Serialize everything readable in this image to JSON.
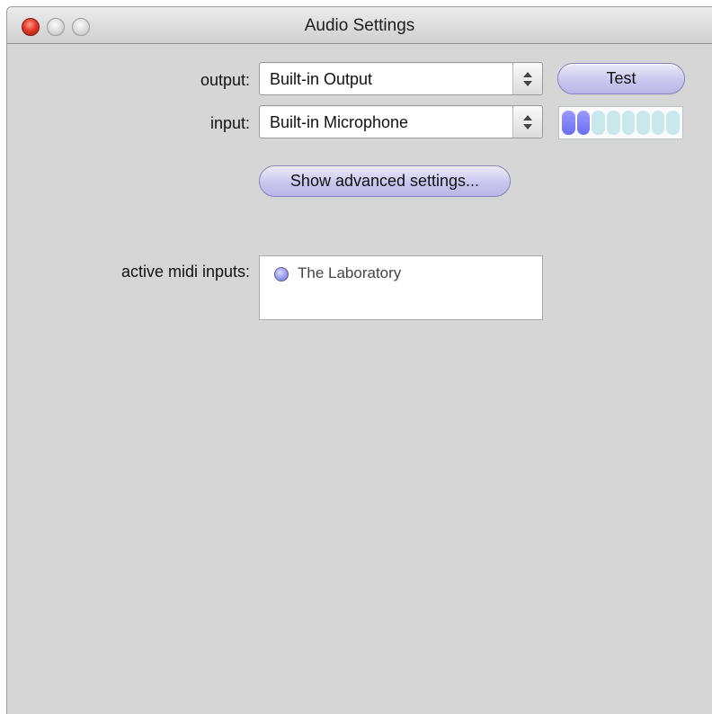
{
  "window": {
    "title": "Audio Settings"
  },
  "output": {
    "label": "output:",
    "value": "Built-in Output"
  },
  "input": {
    "label": "input:",
    "value": "Built-in Microphone"
  },
  "test_button": {
    "label": "Test"
  },
  "advanced_button": {
    "label": "Show advanced settings..."
  },
  "level_meter": {
    "segments_total": 8,
    "segments_lit": 2,
    "lit_color": "#6b6ef0",
    "unlit_color": "#c8e8ee"
  },
  "midi": {
    "label": "active midi inputs:",
    "items": [
      {
        "name": "The Laboratory"
      }
    ]
  }
}
